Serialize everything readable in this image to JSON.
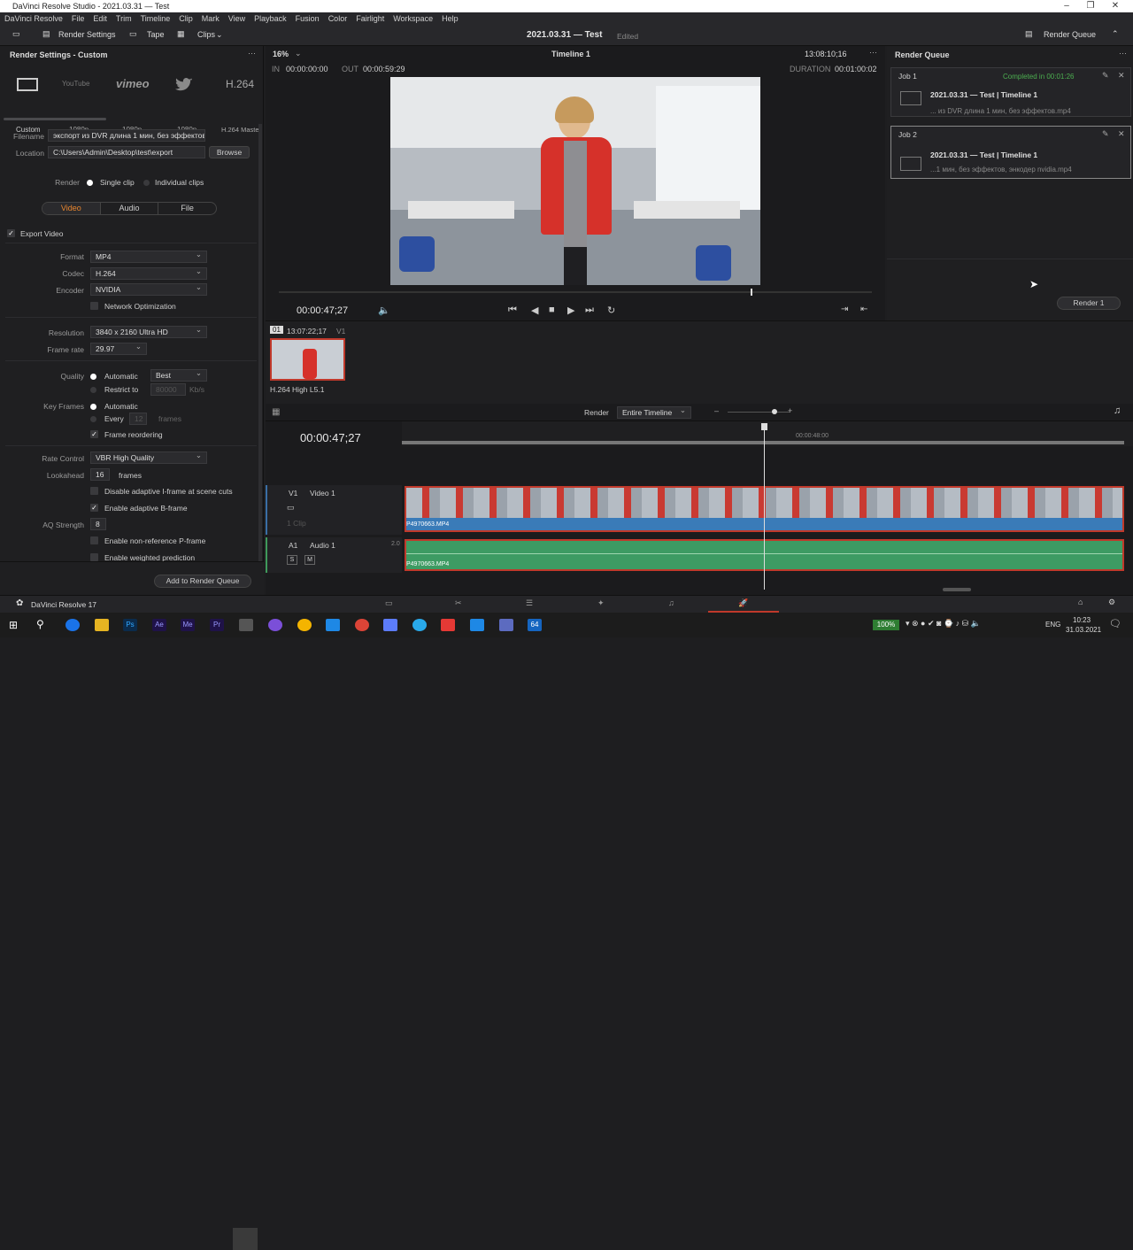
{
  "window": {
    "title": "DaVinci Resolve Studio - 2021.03.31 — Test"
  },
  "menu": [
    "DaVinci Resolve",
    "File",
    "Edit",
    "Trim",
    "Timeline",
    "Clip",
    "Mark",
    "View",
    "Playback",
    "Fusion",
    "Color",
    "Fairlight",
    "Workspace",
    "Help"
  ],
  "toolbar": {
    "render_settings": "Render Settings",
    "tape": "Tape",
    "clips": "Clips",
    "project": "2021.03.31 — Test",
    "status": "Edited",
    "render_queue": "Render Queue"
  },
  "left": {
    "title": "Render Settings - Custom",
    "presets": [
      {
        "name": "Custom",
        "sub": ""
      },
      {
        "name": "YouTube",
        "sub": "1080p"
      },
      {
        "name": "vimeo",
        "sub": "1080p"
      },
      {
        "name": "Twitter",
        "sub": "1080p"
      },
      {
        "name": "H.264",
        "sub": "H.264 Master"
      }
    ],
    "filename_label": "Filename",
    "filename": "экспорт из DVR длина 1 мин, без эффектов",
    "location_label": "Location",
    "location": "C:\\Users\\Admin\\Desktop\\test\\export",
    "browse": "Browse",
    "render_label": "Render",
    "single_clip": "Single clip",
    "individual_clips": "Individual clips",
    "tabs": [
      "Video",
      "Audio",
      "File"
    ],
    "export_video": "Export Video",
    "format_label": "Format",
    "format": "MP4",
    "codec_label": "Codec",
    "codec": "H.264",
    "encoder_label": "Encoder",
    "encoder": "NVIDIA",
    "network_opt": "Network Optimization",
    "resolution_label": "Resolution",
    "resolution": "3840 x 2160 Ultra HD",
    "framerate_label": "Frame rate",
    "framerate": "29.97",
    "quality_label": "Quality",
    "quality_auto": "Automatic",
    "quality_val": "Best",
    "restrict": "Restrict to",
    "restrict_val": "80000",
    "restrict_unit": "Kb/s",
    "keyframes_label": "Key Frames",
    "kf_auto": "Automatic",
    "kf_every": "Every",
    "kf_val": "12",
    "kf_unit": "frames",
    "frame_reorder": "Frame reordering",
    "rate_label": "Rate Control",
    "rate": "VBR High Quality",
    "lookahead_label": "Lookahead",
    "lookahead": "16",
    "lookahead_unit": "frames",
    "disable_iframe": "Disable adaptive I-frame at scene cuts",
    "enable_bframe": "Enable adaptive B-frame",
    "aq_label": "AQ Strength",
    "aq": "8",
    "nonref": "Enable non-reference P-frame",
    "weighted": "Enable weighted prediction",
    "add_queue": "Add to Render Queue"
  },
  "viewer": {
    "zoom": "16%",
    "timeline": "Timeline 1",
    "tc_top": "13:08:10;16",
    "in_label": "IN",
    "in": "00:00:00:00",
    "out_label": "OUT",
    "out": "00:00:59:29",
    "duration_label": "DURATION",
    "duration": "00:01:00:02",
    "current": "00:00:47;27"
  },
  "clip": {
    "num": "01",
    "tc": "13:07:22;17",
    "track": "V1",
    "name": "H.264 High L5.1"
  },
  "queue": {
    "title": "Render Queue",
    "jobs": [
      {
        "label": "Job 1",
        "status": "Completed in 00:01:26",
        "name": "2021.03.31 — Test | Timeline 1",
        "file": "... из DVR длина 1 мин, без эффектов.mp4"
      },
      {
        "label": "Job 2",
        "status": "",
        "name": "2021.03.31 — Test | Timeline 1",
        "file": "...1 мин, без эффектов, энкодер nvidia.mp4"
      }
    ],
    "render_btn": "Render 1"
  },
  "timeline": {
    "render_label": "Render",
    "render_val": "Entire Timeline",
    "tc": "00:00:47;27",
    "ruler": "00:00:48:00",
    "v1": "V1",
    "v1_name": "Video 1",
    "v1_clips": "1 Clip",
    "clip_name": "P4970663.MP4",
    "a1": "A1",
    "a1_name": "Audio 1",
    "a1_level": "2.0",
    "audio_clip": "P4970663.MP4",
    "s": "S",
    "m": "M"
  },
  "footer": {
    "app": "DaVinci Resolve 17"
  },
  "tray": {
    "battery": "100%",
    "lang": "ENG",
    "time": "10:23",
    "date": "31.03.2021"
  }
}
